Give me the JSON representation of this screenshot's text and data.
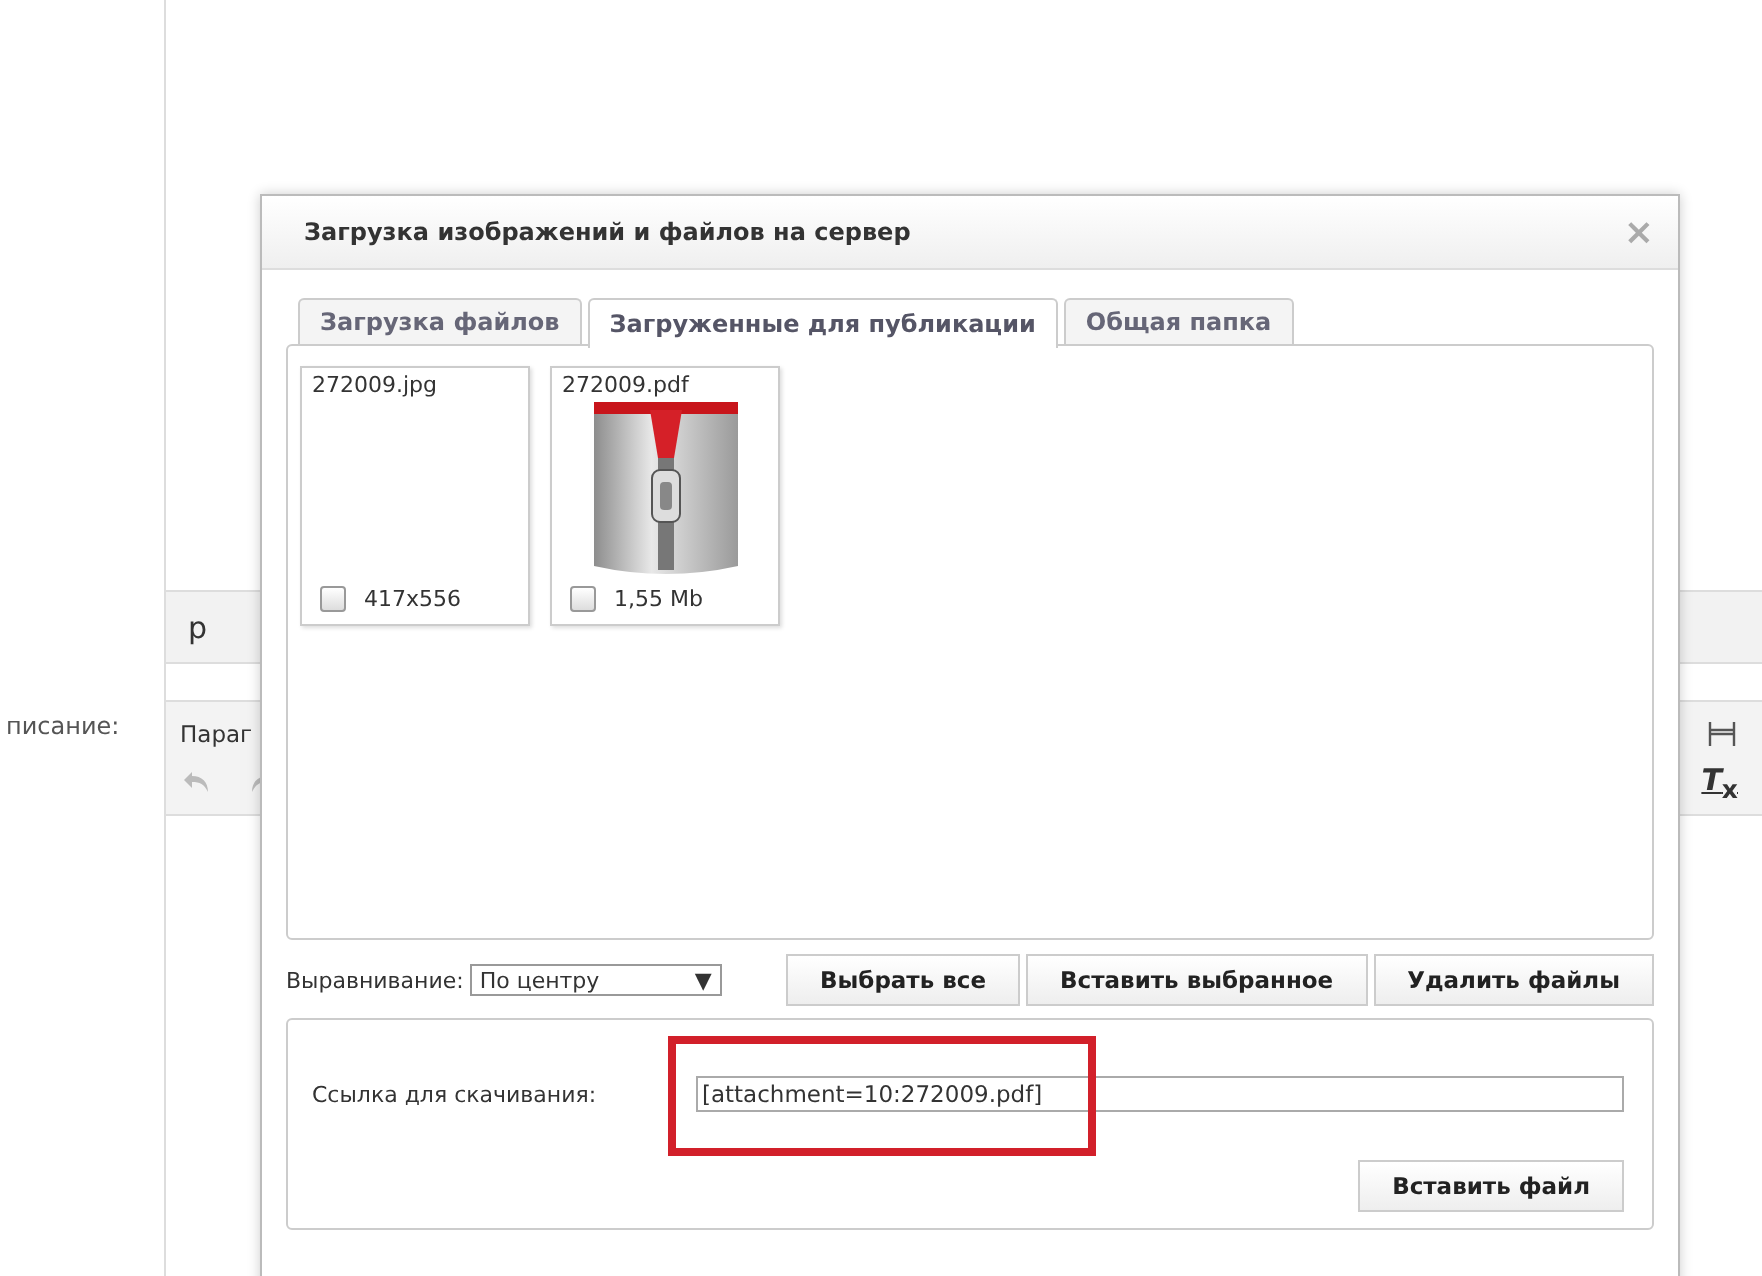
{
  "background": {
    "status_bar": "p",
    "field_label": "писание:",
    "format_dropdown": "Параг",
    "remove_format": "*T*$_{x}$"
  },
  "dialog": {
    "title": "Загрузка изображений и файлов на сервер",
    "close": "×",
    "tabs": [
      {
        "label": "Загрузка файлов",
        "selected": false
      },
      {
        "label": "Загруженные для публикации",
        "selected": true
      },
      {
        "label": "Общая папка",
        "selected": false
      }
    ],
    "files": [
      {
        "name": "272009.jpg",
        "kind": "image",
        "checked": false,
        "info": "417x556"
      },
      {
        "name": "272009.pdf",
        "kind": "archive",
        "checked": false,
        "info": "1,55 Mb"
      }
    ],
    "alignment": {
      "label": "Выравнивание:",
      "value": "По центру",
      "arrow": "▼"
    },
    "buttons": [
      "Выбрать все",
      "Вставить выбранное",
      "Удалить файлы"
    ],
    "link": {
      "label": "Ссылка для скачивания:",
      "value": "[attachment=10:272009.pdf]"
    },
    "insert_button": "Вставить файл"
  }
}
